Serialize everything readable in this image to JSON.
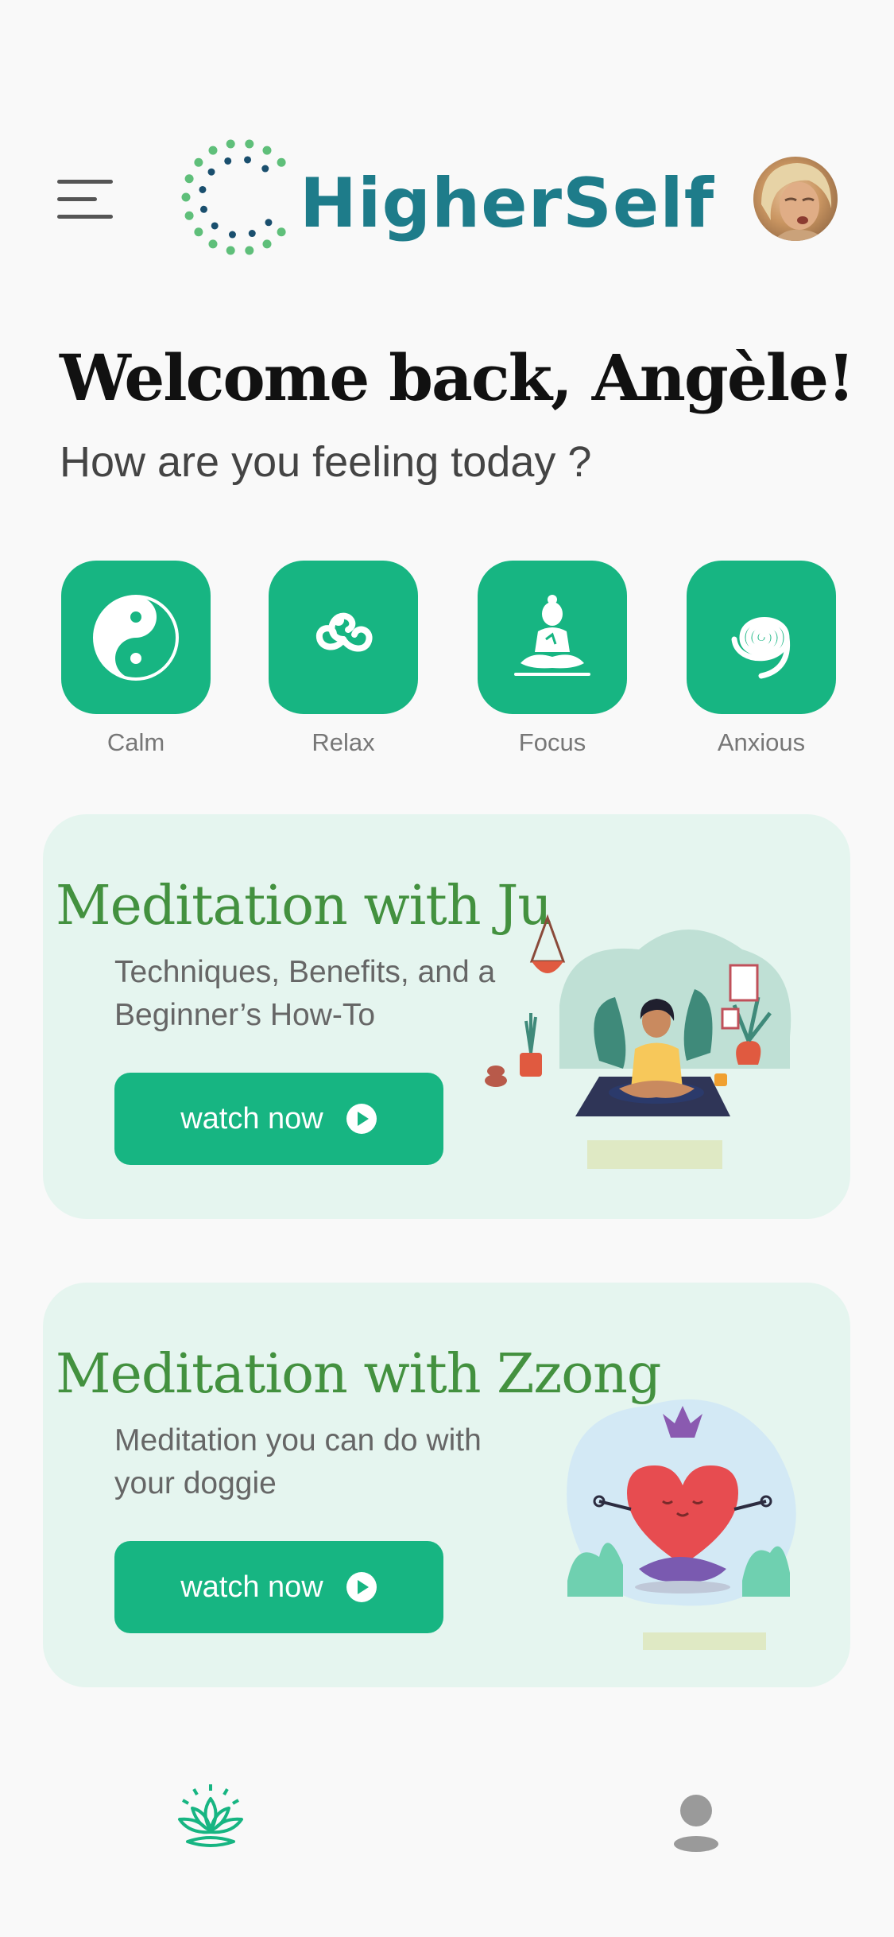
{
  "app": {
    "name": "HigherSelf"
  },
  "header": {
    "menu_icon": "hamburger-menu-icon",
    "avatar_icon": "user-avatar"
  },
  "greeting": {
    "title": "Welcome back, Angèle!",
    "subtitle": "How are you feeling today ?"
  },
  "moods": [
    {
      "label": "Calm",
      "icon": "yin-yang-icon"
    },
    {
      "label": "Relax",
      "icon": "triskelion-icon"
    },
    {
      "label": "Focus",
      "icon": "buddha-icon"
    },
    {
      "label": "Anxious",
      "icon": "spiral-icon"
    }
  ],
  "cards": [
    {
      "title": "Meditation  with Ju",
      "description": "Techniques, Benefits, and a Beginner’s How-To",
      "button_label": "watch now"
    },
    {
      "title": "Meditation with Zzong",
      "description": "Meditation you can do with your doggie",
      "button_label": "watch now"
    }
  ],
  "nav": {
    "home_icon": "lotus-icon",
    "profile_icon": "profile-icon"
  },
  "colors": {
    "accent": "#17b582",
    "card_bg": "#e5f5ef",
    "title_green": "#43913f",
    "logo_teal": "#1e7c8a"
  }
}
